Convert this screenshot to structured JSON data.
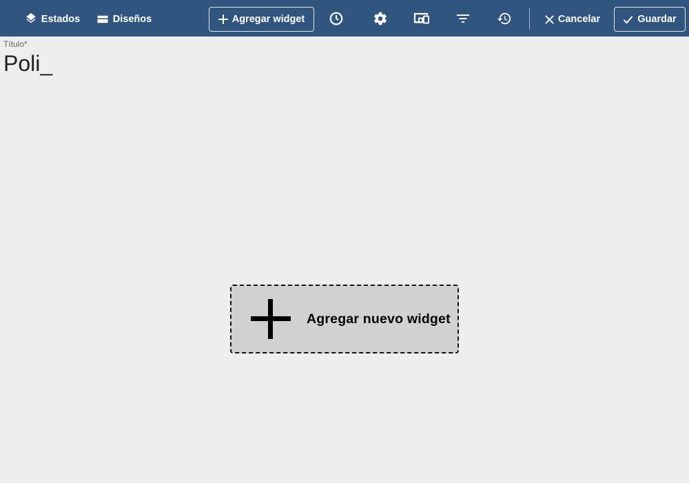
{
  "toolbar": {
    "states_label": "Estados",
    "layouts_label": "Diseños",
    "add_widget_label": "Agregar widget",
    "cancel_label": "Cancelar",
    "save_label": "Guardar",
    "icons": [
      "layers-icon",
      "layout-icon",
      "plus-icon",
      "clock-icon",
      "gear-icon",
      "devices-icon",
      "filter-icon",
      "history-icon",
      "close-icon",
      "check-icon"
    ]
  },
  "title_field": {
    "label": "Título*",
    "value": "Poli_"
  },
  "placeholder": {
    "add_new_widget_label": "Agregar nuevo widget"
  },
  "colors": {
    "toolbar_bg": "#305680",
    "page_bg": "#eeeeee",
    "placeholder_bg": "#d1d1d1"
  }
}
